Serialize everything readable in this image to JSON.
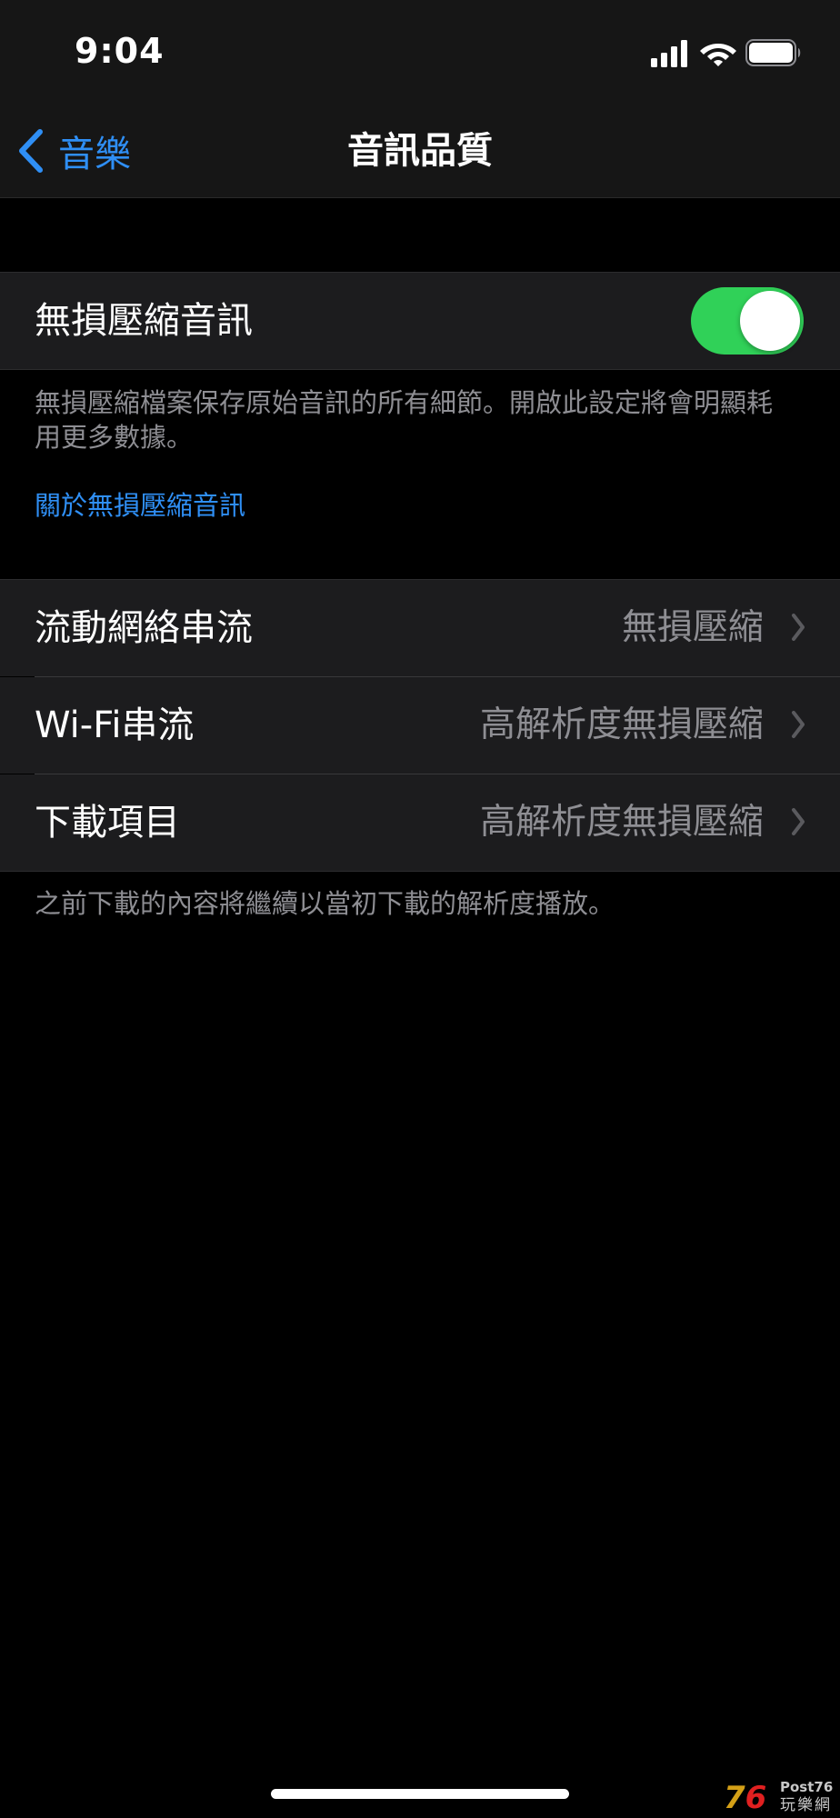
{
  "status_bar": {
    "time": "9:04",
    "icons": [
      "cellular-signal-icon",
      "wifi-icon",
      "battery-icon"
    ]
  },
  "nav": {
    "back_label": "音樂",
    "title": "音訊品質"
  },
  "lossless": {
    "label": "無損壓縮音訊",
    "toggle_on": true,
    "footnote": "無損壓縮檔案保存原始音訊的所有細節。開啟此設定將會明顯耗用更多數據。",
    "link": "關於無損壓縮音訊"
  },
  "quality_rows": [
    {
      "label": "流動網絡串流",
      "value": "無損壓縮"
    },
    {
      "label": "Wi-Fi串流",
      "value": "高解析度無損壓縮"
    },
    {
      "label": "下載項目",
      "value": "高解析度無損壓縮"
    }
  ],
  "downloads_footnote": "之前下載的內容將繼續以當初下載的解析度播放。",
  "watermark": {
    "number_left": "7",
    "number_right": "6",
    "brand": "Post76",
    "brand_cn": "玩樂網"
  },
  "colors": {
    "accent": "#2f8ff5",
    "toggle_on": "#30d158",
    "cell_bg": "#1c1c1e",
    "secondary_text": "#8e8e93"
  }
}
